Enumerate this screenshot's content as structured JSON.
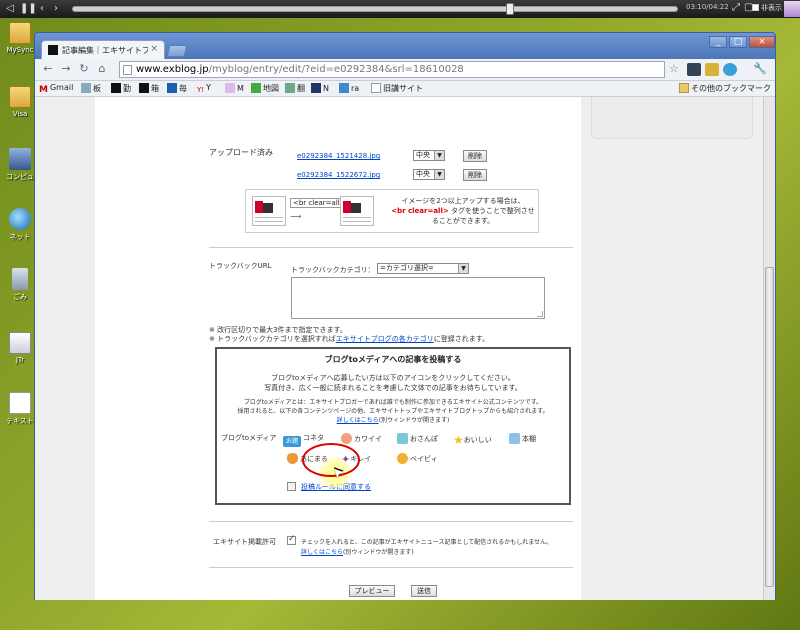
{
  "player": {
    "time": "03:10/04:22",
    "hide_label": "非表示"
  },
  "desktop": {
    "icons": [
      {
        "label": "MySync"
      },
      {
        "label": "Visa"
      },
      {
        "label": "コンピュ"
      },
      {
        "label": "ネット"
      },
      {
        "label": "ごみ"
      },
      {
        "label": "JTr"
      },
      {
        "label": "テキスト"
      }
    ]
  },
  "browser": {
    "tab_title": "記事編集｜エキサイトブログ",
    "url_host": "www.exblog.jp",
    "url_path": "/myblog/entry/edit/?eid=e0292384&srl=18610028",
    "bookmarks": [
      "Gmail",
      "板",
      "勤",
      "箱",
      "毎",
      "Y",
      "M",
      "地図",
      "翻",
      "N",
      "ra",
      "旧講サイト"
    ],
    "other_bookmarks": "その他のブックマーク"
  },
  "upload": {
    "label": "アップロード済み",
    "files": [
      {
        "name": "e0292384_1521428.jpg",
        "align": "中央",
        "delete": "削除"
      },
      {
        "name": "e0292384_1522672.jpg",
        "align": "中央",
        "delete": "削除"
      }
    ],
    "br_tag": "<br clear=all>",
    "hint_line1": "イメージを2つ以上アップする場合は、",
    "hint_red": "<br clear=all>",
    "hint_line2": " タグを使うことで整列させ",
    "hint_line3": "ることができます。"
  },
  "trackback": {
    "label": "トラックバックURL",
    "category_label": "トラックバックカテゴリ：",
    "category_value": "=カテゴリ選択=",
    "note1": "※ 改行区切りで最大3件まで指定できます。",
    "note2_prefix": "※ トラックバックカテゴリを選択すれば",
    "note2_link": "エキサイトブログの各カテゴリ",
    "note2_suffix": "に登録されます。"
  },
  "media": {
    "title": "ブログtoメディアへの記事を投稿する",
    "line1": "ブログtoメディアへ応募したい方は以下のアイコンをクリックしてください。",
    "line2": "写真付き、広く一般に読まれることを考慮した文体での記事をお待ちしています。",
    "small1": "ブログtoメディアとは：エキサイトブロガーであれば誰でも制作に参加できるエキサイト公式コンテンツです。",
    "small2": "採用されると、以下の各コンテンツページの他、エキサイトトップやエキサイトブログトップからも紹介されます。",
    "detail_link": "詳しくはこちら",
    "detail_suffix": "(別ウィンドウが開きます)",
    "row_label": "ブログtoメディア",
    "categories": [
      {
        "name": "お題",
        "label": "コネタ"
      },
      {
        "name": "カワイイ",
        "label": "カワイイ"
      },
      {
        "name": "おさんぽ",
        "label": "おさんぽ"
      },
      {
        "name": "おいしい",
        "label": "おいしい"
      },
      {
        "name": "本棚",
        "label": "本棚"
      },
      {
        "name": "あにまる",
        "label": "あにまる"
      },
      {
        "name": "キレイ",
        "label": "キレイ"
      },
      {
        "name": "ベイビィ",
        "label": "ベイビィ"
      }
    ],
    "agree_link": "投稿ルールに同意する"
  },
  "excite_permit": {
    "label": "エキサイト掲載許可",
    "text": "チェックを入れると、この記事がエキサイトニュース記事として配信されるかもしれません。",
    "detail_link": "詳しくはこちら",
    "detail_suffix": "(別ウィンドウが開きます)"
  },
  "actions": {
    "preview": "プレビュー",
    "submit": "送信"
  },
  "colors": {
    "link": "#0044cc",
    "highlight_ring": "#dd0000",
    "window_frame": "#5b84c4"
  }
}
